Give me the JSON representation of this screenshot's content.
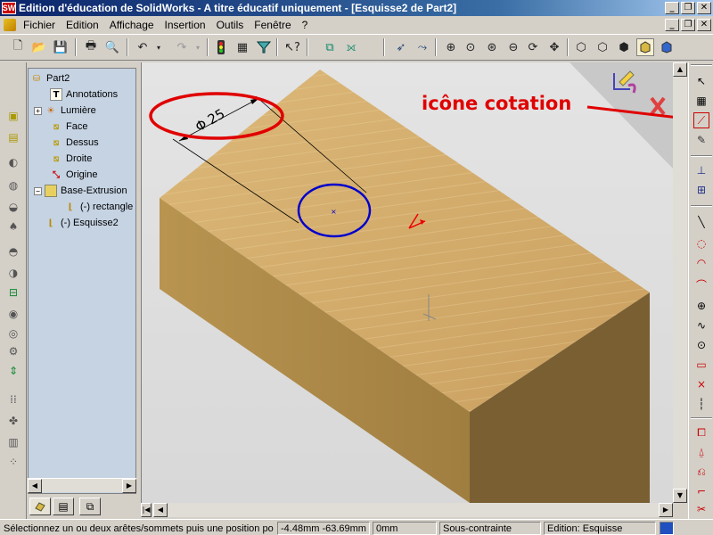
{
  "window": {
    "title": "Edition d'éducation de SolidWorks - A titre éducatif uniquement - [Esquisse2 de Part2]",
    "app_logo_text": "SW",
    "buttons": [
      "_",
      "❐",
      "✕"
    ]
  },
  "menubar": {
    "items": [
      "Fichier",
      "Edition",
      "Affichage",
      "Insertion",
      "Outils",
      "Fenêtre",
      "?"
    ]
  },
  "tree": {
    "root": "Part2",
    "items": [
      {
        "label": "Annotations",
        "icon": "annotations-icon"
      },
      {
        "label": "Lumière",
        "icon": "lighting-icon"
      },
      {
        "label": "Face",
        "icon": "plane-icon"
      },
      {
        "label": "Dessus",
        "icon": "plane-icon"
      },
      {
        "label": "Droite",
        "icon": "plane-icon"
      },
      {
        "label": "Origine",
        "icon": "origin-icon"
      },
      {
        "label": "Base-Extrusion",
        "icon": "extrusion-icon"
      },
      {
        "label": "(-) rectangle",
        "icon": "sketch-icon"
      },
      {
        "label": "(-) Esquisse2",
        "icon": "sketch-icon"
      }
    ]
  },
  "viewport": {
    "dimension_text": "25",
    "diameter_symbol": "Φ",
    "annotation_label": "icône cotation"
  },
  "statusbar": {
    "message": "Sélectionnez un ou deux arêtes/sommets puis une position pour",
    "coords": "-4.48mm -63.69mm",
    "z": "0mm",
    "state": "Sous-contrainte",
    "mode": "Edition: Esquisse"
  },
  "colors": {
    "block_top": "#d4ad6a",
    "block_front": "#ad8a4a",
    "block_side": "#7d6235",
    "circle": "#0000cc",
    "annotation": "#e00000"
  }
}
